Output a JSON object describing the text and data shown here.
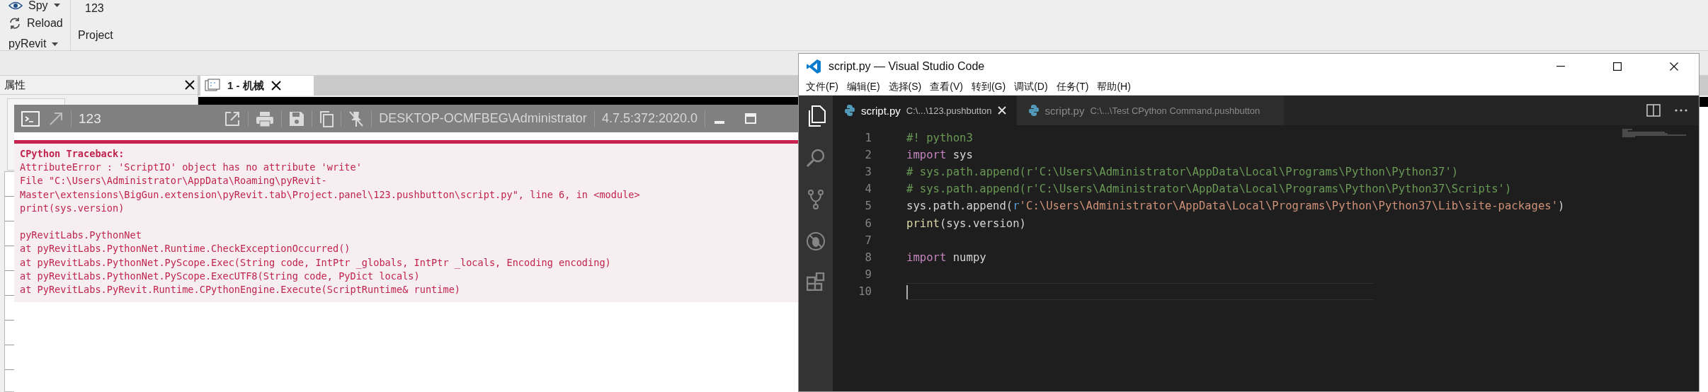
{
  "ribbon": {
    "buttons": [
      {
        "label": "Spy",
        "dropdown": true
      },
      {
        "label": "Reload",
        "dropdown": false
      }
    ],
    "panel_button": "123",
    "tab_menu": "pyRevit",
    "panel_title": "Project"
  },
  "properties_panel": {
    "title": "属性"
  },
  "view_tabs": [
    {
      "label": "1 - 机械",
      "selected": true
    }
  ],
  "output_window": {
    "title": "123",
    "user": "DESKTOP-OCMFBEG\\Administrator",
    "version": "4.7.5:372:2020.0",
    "lines": [
      {
        "kind": "heading",
        "text": "CPython Traceback:",
        "gap_before": false
      },
      {
        "kind": "text",
        "text": "AttributeError : 'ScriptIO' object has no attribute 'write'",
        "gap_before": false
      },
      {
        "kind": "text",
        "text": "File \"C:\\Users\\Administrator\\AppData\\Roaming\\pyRevit-",
        "gap_before": false
      },
      {
        "kind": "text",
        "text": "Master\\extensions\\BigGun.extension\\pyRevit.tab\\Project.panel\\123.pushbutton\\script.py\", line 6, in <module>",
        "gap_before": false
      },
      {
        "kind": "text",
        "text": "print(sys.version)",
        "gap_before": false
      },
      {
        "kind": "text",
        "text": "pyRevitLabs.PythonNet",
        "gap_before": true
      },
      {
        "kind": "text",
        "text": "at pyRevitLabs.PythonNet.Runtime.CheckExceptionOccurred()",
        "gap_before": false
      },
      {
        "kind": "text",
        "text": "at pyRevitLabs.PythonNet.PyScope.Exec(String code, IntPtr _globals, IntPtr _locals, Encoding encoding)",
        "gap_before": false
      },
      {
        "kind": "text",
        "text": "at pyRevitLabs.PythonNet.PyScope.ExecUTF8(String code, PyDict locals)",
        "gap_before": false
      },
      {
        "kind": "text",
        "text": "at PyRevitLabs.PyRevit.Runtime.CPythonEngine.Execute(ScriptRuntime& runtime)",
        "gap_before": false
      }
    ]
  },
  "vscode": {
    "title": "script.py — Visual Studio Code",
    "menu": [
      "文件(F)",
      "编辑(E)",
      "选择(S)",
      "查看(V)",
      "转到(G)",
      "调试(D)",
      "任务(T)",
      "帮助(H)"
    ],
    "tabs": [
      {
        "name": "script.py",
        "path": "C:\\...\\123.pushbutton",
        "selected": true
      },
      {
        "name": "script.py",
        "path": "C:\\...\\Test CPython Command.pushbutton",
        "selected": false
      }
    ],
    "lines": [
      {
        "number": "1",
        "cursor": false,
        "tokens": [
          {
            "kind": "comment",
            "text": "#! python3"
          }
        ]
      },
      {
        "number": "2",
        "cursor": false,
        "tokens": [
          {
            "kind": "keyword",
            "text": "import"
          },
          {
            "kind": "plain",
            "text": " sys"
          }
        ]
      },
      {
        "number": "3",
        "cursor": false,
        "tokens": [
          {
            "kind": "comment",
            "text": "# sys.path.append(r'C:\\Users\\Administrator\\AppData\\Local\\Programs\\Python\\Python37')"
          }
        ]
      },
      {
        "number": "4",
        "cursor": false,
        "tokens": [
          {
            "kind": "comment",
            "text": "# sys.path.append(r'C:\\Users\\Administrator\\AppData\\Local\\Programs\\Python\\Python37\\Scripts')"
          }
        ]
      },
      {
        "number": "5",
        "cursor": false,
        "tokens": [
          {
            "kind": "plain",
            "text": "sys.path.append("
          },
          {
            "kind": "prefix",
            "text": "r"
          },
          {
            "kind": "string",
            "text": "'C:\\Users\\Administrator\\AppData\\Local\\Programs\\Python\\Python37\\Lib\\site-packages'"
          },
          {
            "kind": "plain",
            "text": ")"
          }
        ]
      },
      {
        "number": "6",
        "cursor": false,
        "tokens": [
          {
            "kind": "function",
            "text": "print"
          },
          {
            "kind": "plain",
            "text": "(sys.version)"
          }
        ]
      },
      {
        "number": "7",
        "cursor": false
      },
      {
        "number": "8",
        "cursor": false,
        "tokens": [
          {
            "kind": "keyword",
            "text": "import"
          },
          {
            "kind": "plain",
            "text": " numpy"
          }
        ]
      },
      {
        "number": "9",
        "cursor": false
      },
      {
        "number": "10",
        "cursor": true
      }
    ]
  }
}
